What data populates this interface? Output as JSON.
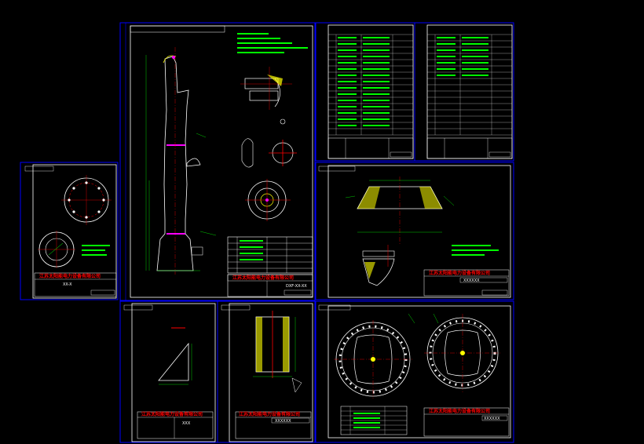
{
  "sheets": [
    {
      "id": "main-frame",
      "title_block": {
        "company": "江苏太阳能电力设备有限公司",
        "code": "DXF-XX-XX"
      }
    },
    {
      "id": "parts-list-1",
      "title_block": {
        "company": "",
        "code": ""
      }
    },
    {
      "id": "parts-list-2",
      "title_block": {
        "company": "",
        "code": ""
      }
    },
    {
      "id": "flange-sheet",
      "title_block": {
        "company": "江苏太阳能电力设备有限公司",
        "code": "XX-X"
      }
    },
    {
      "id": "base-ring-sheet",
      "title_block": {
        "company": "江苏太阳能电力设备有限公司",
        "code": "XXXXXX"
      }
    },
    {
      "id": "rib-sheet",
      "title_block": {
        "company": "江苏太阳能电力设备有限公司",
        "code": "XXX"
      }
    },
    {
      "id": "sleeve-sheet",
      "title_block": {
        "company": "江苏太阳能电力设备有限公司",
        "code": "XXXXXX"
      }
    },
    {
      "id": "ring-plate-sheet",
      "title_block": {
        "company": "江苏太阳能电力设备有限公司",
        "code": "XXXXXX"
      }
    }
  ],
  "colors": {
    "frame": "#0000ff",
    "outline": "#ffffff",
    "dim": "#00ff00",
    "center": "#ff0000",
    "hatch": "#ffff00",
    "label": "#ff00ff",
    "leader": "#00ffff"
  }
}
